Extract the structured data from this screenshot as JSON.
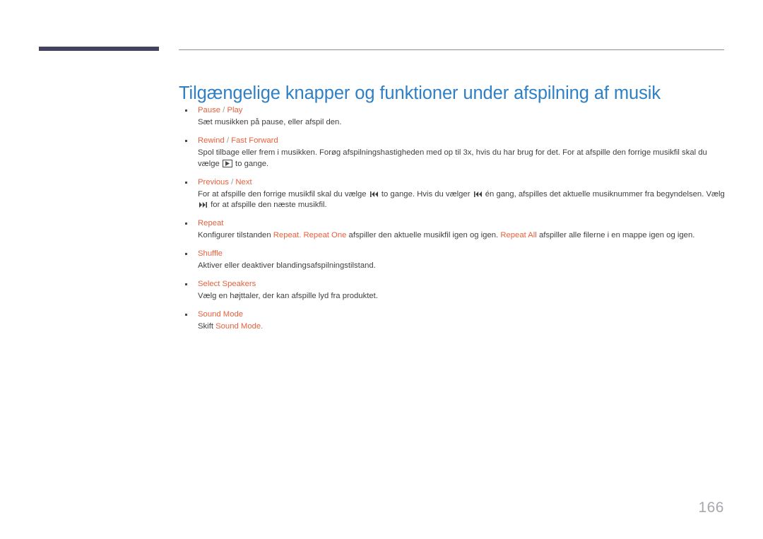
{
  "document": {
    "title": "Tilgængelige knapper og funktioner under afspilning af musik",
    "page_number": "166",
    "accent_color": "#e8603c",
    "title_color": "#2f7fc4",
    "rule_color": "#42425e"
  },
  "entries": [
    {
      "term_primary": "Pause",
      "term_separator": " / ",
      "term_secondary": "Play",
      "desc_parts": [
        {
          "type": "text",
          "value": "Sæt musikken på pause, eller afspil den."
        }
      ]
    },
    {
      "term_primary": "Rewind",
      "term_separator": " / ",
      "term_secondary": "Fast Forward",
      "desc_parts": [
        {
          "type": "text",
          "value": "Spol tilbage eller frem i musikken. Forøg afspilningshastigheden med op til 3x, hvis du har brug for det. For at afspille den forrige musikfil skal du vælge "
        },
        {
          "type": "icon",
          "value": "play-button-icon"
        },
        {
          "type": "text",
          "value": " to gange."
        }
      ]
    },
    {
      "term_primary": "Previous",
      "term_separator": " / ",
      "term_secondary": "Next",
      "desc_parts": [
        {
          "type": "text",
          "value": "For at afspille den forrige musikfil skal du vælge "
        },
        {
          "type": "icon",
          "value": "previous-track-icon"
        },
        {
          "type": "text",
          "value": " to gange. Hvis du vælger "
        },
        {
          "type": "icon",
          "value": "previous-track-icon"
        },
        {
          "type": "text",
          "value": " én gang, afspilles det aktuelle musiknummer fra begyndelsen. Vælg "
        },
        {
          "type": "icon",
          "value": "next-track-icon"
        },
        {
          "type": "text",
          "value": " for at afspille den næste musikfil."
        }
      ]
    },
    {
      "term_primary": "Repeat",
      "term_separator": "",
      "term_secondary": "",
      "desc_parts": [
        {
          "type": "text",
          "value": "Konfigurer tilstanden "
        },
        {
          "type": "highlight",
          "value": "Repeat."
        },
        {
          "type": "text",
          "value": " "
        },
        {
          "type": "highlight",
          "value": "Repeat One"
        },
        {
          "type": "text",
          "value": " afspiller den aktuelle musikfil igen og igen. "
        },
        {
          "type": "highlight",
          "value": "Repeat All"
        },
        {
          "type": "text",
          "value": " afspiller alle filerne i en mappe igen og igen."
        }
      ]
    },
    {
      "term_primary": "Shuffle",
      "term_separator": "",
      "term_secondary": "",
      "desc_parts": [
        {
          "type": "text",
          "value": "Aktiver eller deaktiver blandingsafspilningstilstand."
        }
      ]
    },
    {
      "term_primary": "Select Speakers",
      "term_separator": "",
      "term_secondary": "",
      "desc_parts": [
        {
          "type": "text",
          "value": "Vælg en højttaler, der kan afspille lyd fra produktet."
        }
      ]
    },
    {
      "term_primary": "Sound Mode",
      "term_separator": "",
      "term_secondary": "",
      "desc_parts": [
        {
          "type": "text",
          "value": "Skift "
        },
        {
          "type": "highlight",
          "value": "Sound Mode."
        }
      ]
    }
  ]
}
